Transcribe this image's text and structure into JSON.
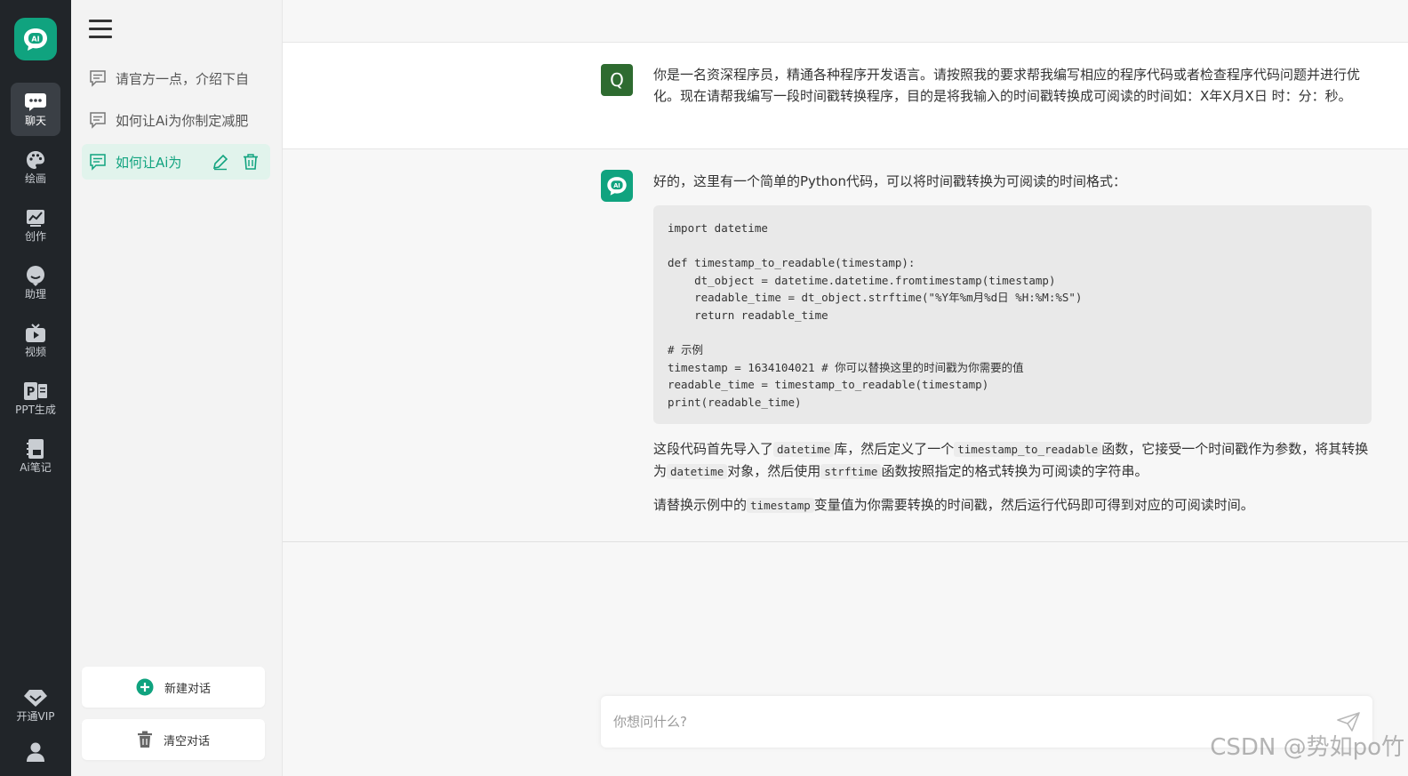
{
  "rail": {
    "items": [
      {
        "label": "聊天",
        "icon": "chat-icon"
      },
      {
        "label": "绘画",
        "icon": "palette-icon"
      },
      {
        "label": "创作",
        "icon": "chart-icon"
      },
      {
        "label": "助理",
        "icon": "assistant-icon"
      },
      {
        "label": "视频",
        "icon": "tv-icon"
      },
      {
        "label": "PPT生成",
        "icon": "ppt-icon"
      },
      {
        "label": "Ai笔记",
        "icon": "notebook-icon"
      }
    ],
    "vip_label": "开通VIP"
  },
  "sidebar": {
    "conversations": [
      {
        "title": "请官方一点，介绍下自"
      },
      {
        "title": "如何让Ai为你制定减肥"
      },
      {
        "title": "如何让Ai为"
      }
    ],
    "new_chat_label": "新建对话",
    "clear_chat_label": "清空对话"
  },
  "chat": {
    "user_avatar": "Q",
    "user_message": "你是一名资深程序员，精通各种程序开发语言。请按照我的要求帮我编写相应的程序代码或者检查程序代码问题并进行优化。现在请帮我编写一段时间戳转换程序，目的是将我输入的时间戳转换成可阅读的时间如：X年X月X日 时：分：秒。",
    "ai_intro": "好的，这里有一个简单的Python代码，可以将时间戳转换为可阅读的时间格式：",
    "code": "import datetime\n\ndef timestamp_to_readable(timestamp):\n    dt_object = datetime.datetime.fromtimestamp(timestamp)\n    readable_time = dt_object.strftime(\"%Y年%m月%d日 %H:%M:%S\")\n    return readable_time\n\n# 示例\ntimestamp = 1634104021 # 你可以替换这里的时间戳为你需要的值\nreadable_time = timestamp_to_readable(timestamp)\nprint(readable_time)",
    "para1": {
      "t1": "这段代码首先导入了",
      "c1": "datetime",
      "t2": "库，然后定义了一个",
      "c2": "timestamp_to_readable",
      "t3": "函数，它接受一个时间戳作为参数，将其转换为",
      "c3": "datetime",
      "t4": "对象，然后使用",
      "c4": "strftime",
      "t5": "函数按照指定的格式转换为可阅读的字符串。"
    },
    "para2": {
      "t1": "请替换示例中的",
      "c1": "timestamp",
      "t2": "变量值为你需要转换的时间戳，然后运行代码即可得到对应的可阅读时间。"
    }
  },
  "input": {
    "placeholder": "你想问什么?"
  },
  "watermark": "CSDN @势如po竹",
  "colors": {
    "accent": "#10a37f",
    "rail_bg": "#212529",
    "user_avatar_bg": "#2e6b30"
  }
}
